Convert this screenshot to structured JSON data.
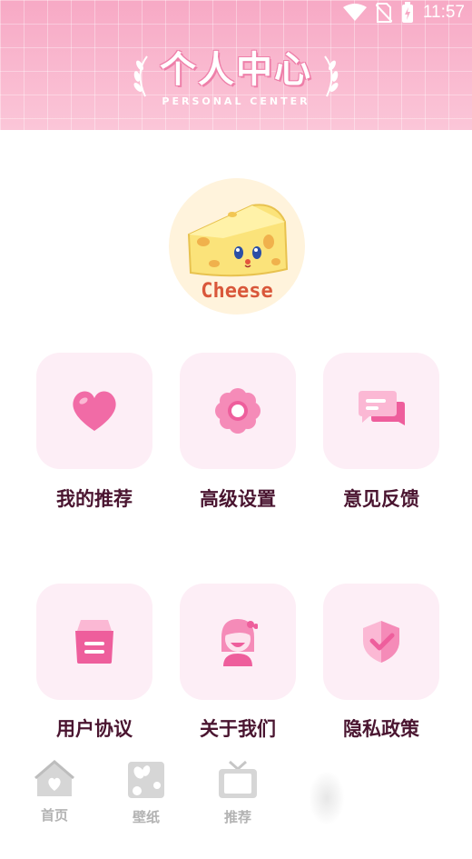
{
  "status_bar": {
    "time": "11:57",
    "icons": [
      "wifi-icon",
      "no-sim-icon",
      "battery-charging-icon"
    ]
  },
  "header": {
    "title": "个人中心",
    "subtitle": "PERSONAL CENTER"
  },
  "profile": {
    "avatar_label": "Cheese",
    "avatar_icon": "cheese-icon"
  },
  "colors": {
    "header_pink": "#f8b9cf",
    "icon_pink": "#f16ba6",
    "tile_bg": "#fdeef6",
    "label_text": "#4a1530",
    "nav_gray": "#b3b3b3"
  },
  "menu": {
    "items": [
      {
        "label": "我的推荐",
        "icon": "heart-icon"
      },
      {
        "label": "高级设置",
        "icon": "flower-icon"
      },
      {
        "label": "意见反馈",
        "icon": "chat-bubbles-icon"
      },
      {
        "label": "用户协议",
        "icon": "document-bag-icon"
      },
      {
        "label": "关于我们",
        "icon": "girl-avatar-icon"
      },
      {
        "label": "隐私政策",
        "icon": "shield-check-icon"
      }
    ]
  },
  "bottom_nav": {
    "items": [
      {
        "label": "首页",
        "icon": "home-icon"
      },
      {
        "label": "壁纸",
        "icon": "wallpaper-icon"
      },
      {
        "label": "推荐",
        "icon": "tv-icon"
      }
    ]
  }
}
